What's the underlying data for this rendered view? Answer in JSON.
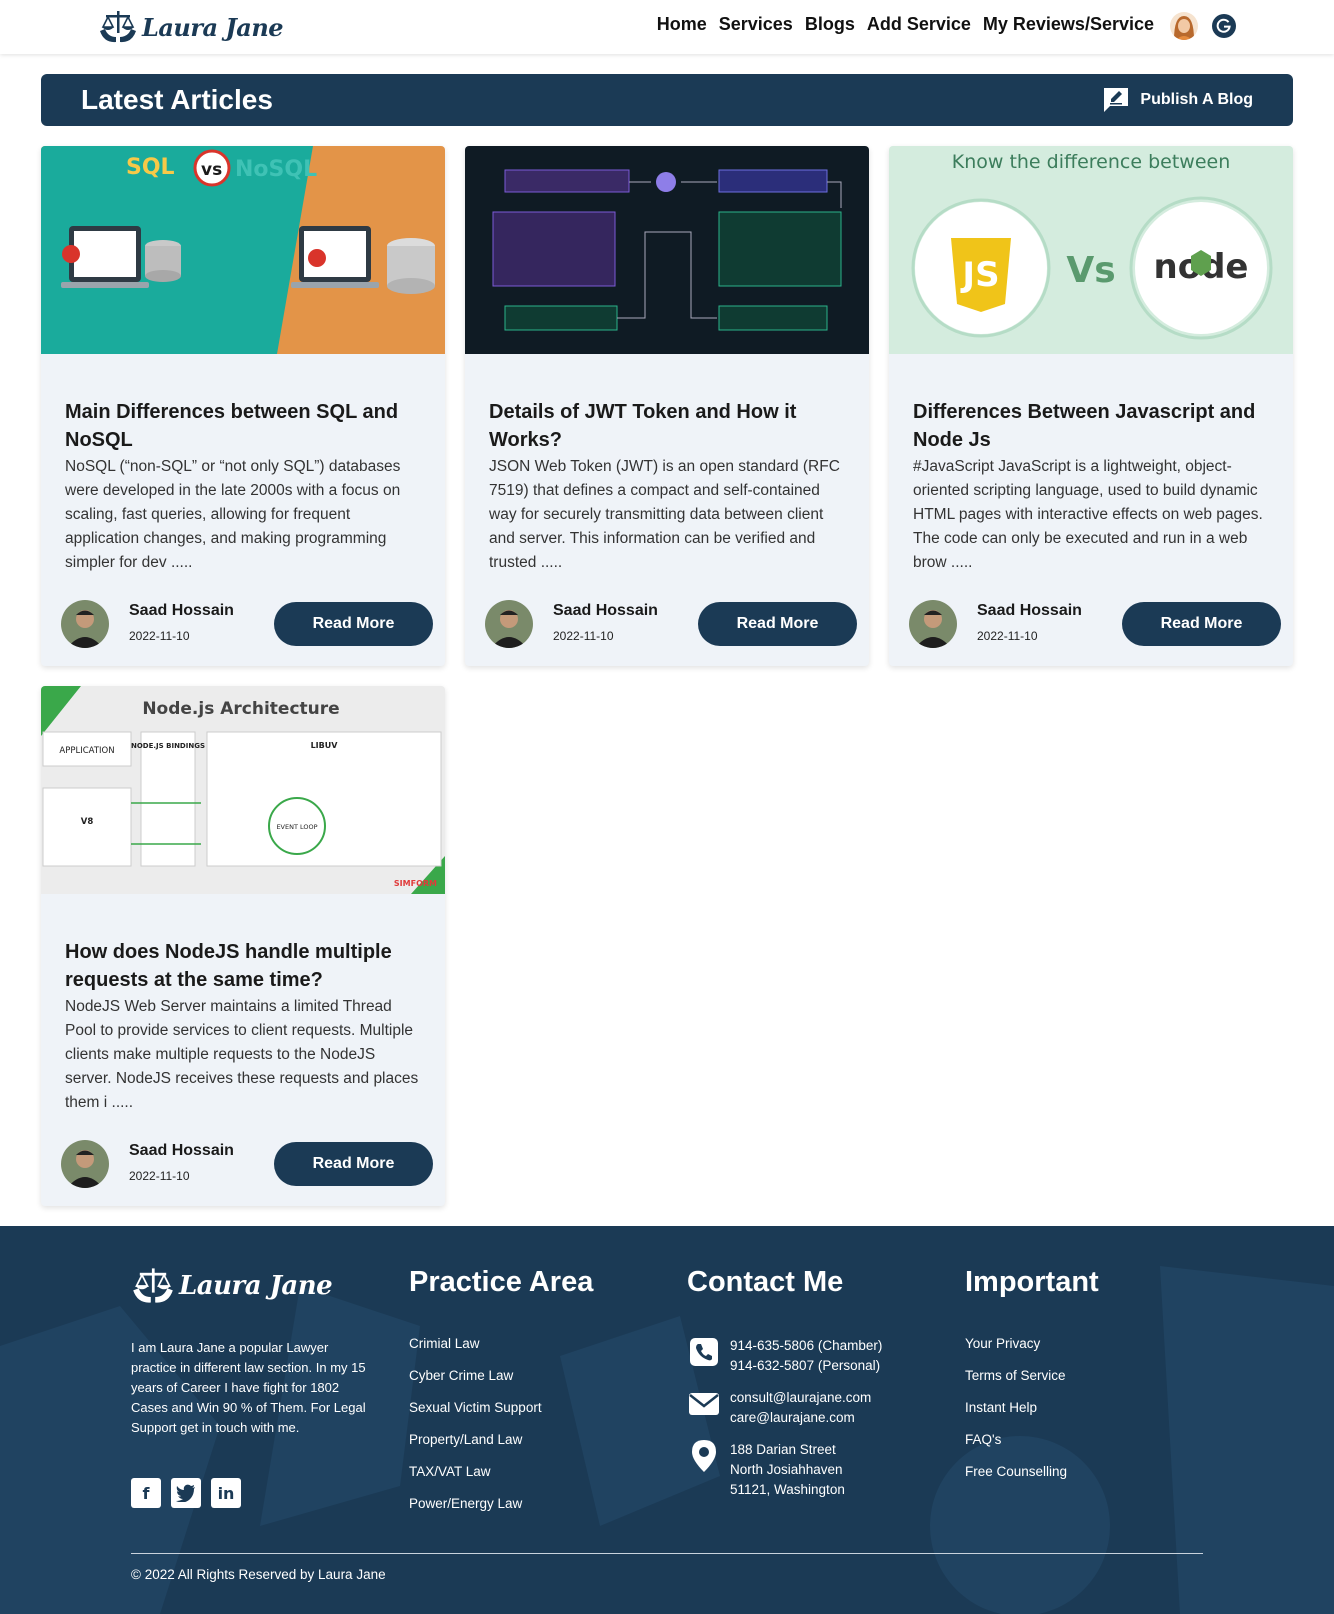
{
  "brand": {
    "name": "Laura Jane",
    "logo_icon": "scales-of-justice-icon"
  },
  "nav": {
    "links": [
      "Home",
      "Services",
      "Blogs",
      "Add Service",
      "My Reviews/Service"
    ],
    "avatar": "user-avatar",
    "google_icon": "google-icon"
  },
  "banner": {
    "title": "Latest Articles",
    "publish_label": "Publish A Blog",
    "publish_icon": "edit-message-icon"
  },
  "articles": [
    {
      "image": "sql-vs-nosql-illustration",
      "image_texts": [
        "SQL",
        "vs",
        "NoSQL"
      ],
      "title": "Main Differences between SQL and NoSQL",
      "excerpt": "NoSQL (“non-SQL” or “not only SQL”) databases were developed in the late 2000s with a focus on scaling, fast queries, allowing for frequent application changes, and making programming simpler for dev .....",
      "author": "Saad Hossain",
      "date": "2022-11-10",
      "button": "Read More"
    },
    {
      "image": "jwt-flow-diagram",
      "title": "Details of JWT Token and How it Works?",
      "excerpt": "JSON Web Token (JWT) is an open standard (RFC 7519) that defines a compact and self-contained way for securely transmitting data between client and server. This information can be verified and trusted .....",
      "author": "Saad Hossain",
      "date": "2022-11-10",
      "button": "Read More"
    },
    {
      "image": "js-vs-node-illustration",
      "image_texts": [
        "Know the difference between",
        "JS",
        "Vs",
        "node"
      ],
      "title": "Differences Between Javascript and Node Js",
      "excerpt": "#JavaScript JavaScript is a lightweight, object-oriented scripting language, used to build dynamic HTML pages with interactive effects on web pages. The code can only be executed and run in a web brow .....",
      "author": "Saad Hossain",
      "date": "2022-11-10",
      "button": "Read More"
    },
    {
      "image": "nodejs-architecture-diagram",
      "image_texts": [
        "Node.js Architecture",
        "APPLICATION",
        "NODE.JS BINDINGS",
        "LIBUV",
        "EVENT LOOP",
        "V8",
        "SIMFORM"
      ],
      "title": "How does NodeJS handle multiple requests at the same time?",
      "excerpt": "NodeJS Web Server maintains a limited Thread Pool to provide services to client requests. Multiple clients make multiple requests to the NodeJS server. NodeJS receives these requests and places them i .....",
      "author": "Saad Hossain",
      "date": "2022-11-10",
      "button": "Read More"
    }
  ],
  "footer": {
    "about": "I am Laura Jane a popular Lawyer practice in different law section. In my 15 years of Career I have fight for 1802 Cases and Win 90 % of Them. For Legal Support get in touch with me.",
    "social_icons": [
      "facebook-icon",
      "twitter-icon",
      "linkedin-icon"
    ],
    "practice": {
      "heading": "Practice Area",
      "items": [
        "Crimial Law",
        "Cyber Crime Law",
        "Sexual Victim Support",
        "Property/Land Law",
        "TAX/VAT Law",
        "Power/Energy Law"
      ]
    },
    "contact": {
      "heading": "Contact Me",
      "phone": [
        "914-635-5806 (Chamber)",
        "914-632-5807 (Personal)"
      ],
      "email": [
        "consult@laurajane.com",
        "care@laurajane.com"
      ],
      "address": [
        "188 Darian Street",
        "North Josiahhaven",
        "51121, Washington"
      ]
    },
    "important": {
      "heading": "Important",
      "items": [
        "Your Privacy",
        "Terms of Service",
        "Instant Help",
        "FAQ's",
        "Free Counselling"
      ]
    },
    "copyright": "© 2022 All Rights Reserved by Laura Jane"
  },
  "colors": {
    "primary": "#1b3a55",
    "card_bg": "#eff3f8"
  }
}
